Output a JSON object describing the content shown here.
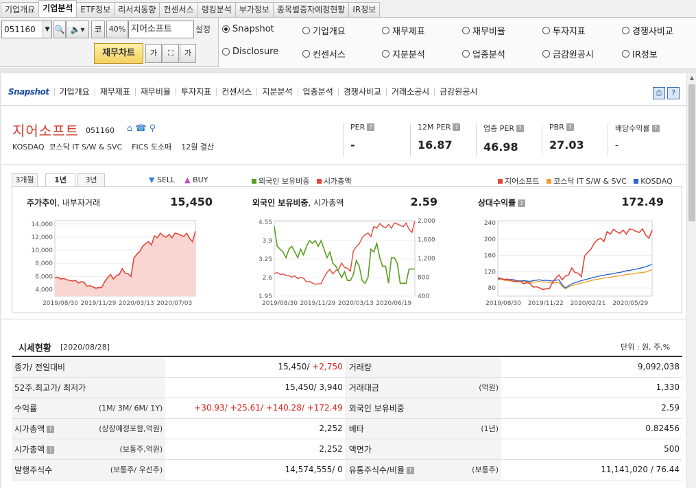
{
  "top_tabs": [
    "기업개요",
    "기업분석",
    "ETF정보",
    "리서치동향",
    "컨센서스",
    "랭킹분석",
    "부가정보",
    "종목별증자예정현황",
    "IR정보"
  ],
  "toolbar": {
    "code": "051160",
    "ratio": "40%",
    "name": "지어소프트",
    "setting": "설정",
    "chart_button": "재무차트",
    "btn_ko": "코",
    "btn_font_small": "가",
    "btn_font_large": "가"
  },
  "radios": [
    {
      "label": "Snapshot",
      "checked": true
    },
    {
      "label": "기업개요",
      "checked": false
    },
    {
      "label": "재무제표",
      "checked": false
    },
    {
      "label": "재무비율",
      "checked": false
    },
    {
      "label": "투자지표",
      "checked": false
    },
    {
      "label": "경쟁사비교",
      "checked": false
    },
    {
      "label": "Disclosure",
      "checked": false
    },
    {
      "label": "컨센서스",
      "checked": false
    },
    {
      "label": "지분분석",
      "checked": false
    },
    {
      "label": "업종분석",
      "checked": false
    },
    {
      "label": "금감원공시",
      "checked": false
    },
    {
      "label": "IR정보",
      "checked": false
    }
  ],
  "subnav": [
    "Snapshot",
    "기업개요",
    "재무제표",
    "재무비율",
    "투자지표",
    "컨센서스",
    "지분분석",
    "업종분석",
    "경쟁사비교",
    "거래소공시",
    "금감원공시"
  ],
  "company": {
    "name": "지어소프트",
    "code": "051160",
    "market": "KOSDAQ",
    "sector": "코스닥 IT S/W & SVC",
    "fics": "FICS 도소매",
    "fiscal": "12월 결산"
  },
  "metrics": [
    {
      "label": "PER",
      "value": "-"
    },
    {
      "label": "12M PER",
      "value": "16.87"
    },
    {
      "label": "업종 PER",
      "value": "46.98"
    },
    {
      "label": "PBR",
      "value": "27.03"
    },
    {
      "label": "배당수익률",
      "value": "-"
    }
  ],
  "period_tabs": [
    "3개월",
    "1년",
    "3년"
  ],
  "active_period": "1년",
  "legend_left": {
    "sell": "SELL",
    "buy": "BUY"
  },
  "legend_mid": [
    "외국인 보유비중",
    "시가총액"
  ],
  "legend_right": [
    "지어소프트",
    "코스닥 IT S/W & SVC",
    "KOSDAQ"
  ],
  "colors": {
    "red": "#e5463a",
    "green": "#5a9d1c",
    "orange": "#f0a030",
    "blue": "#2f66c8",
    "sell": "#3b7fd1",
    "buy": "#c24bc8"
  },
  "chart_titles": {
    "c1_main": "주가추이",
    "c1_sub": ", 내부자거래",
    "c1_value": "15,450",
    "c2_main": "외국인 보유비중",
    "c2_sub": ", 시가총액",
    "c2_value": "2.59",
    "c3_main": "상대수익률",
    "c3_value": "172.49"
  },
  "chart_data": [
    {
      "type": "area",
      "title": "주가추이, 내부자거래",
      "x_ticks": [
        "2019/08/30",
        "2019/11/29",
        "2020/03/13",
        "2020/07/03"
      ],
      "y_ticks": [
        "14,000",
        "12,000",
        "10,000",
        "8,000",
        "6,000",
        "4,000"
      ],
      "ylim": [
        3000,
        14500
      ],
      "series": [
        {
          "name": "주가",
          "values": [
            5800,
            5900,
            5600,
            5700,
            5500,
            5400,
            5300,
            5400,
            5000,
            5200,
            5100,
            4500,
            4600,
            4400,
            4200,
            4300,
            4300,
            5200,
            5800,
            6300,
            5600,
            6100,
            6300,
            7200,
            6500,
            6400,
            6000,
            8800,
            9400,
            9800,
            10600,
            11000,
            11300,
            10800,
            12200,
            11900,
            12600,
            12200,
            12000,
            12400,
            11900,
            12600,
            12500,
            12300,
            12100,
            12600,
            11800,
            11300,
            12900
          ]
        }
      ]
    },
    {
      "type": "line",
      "title": "외국인 보유비중, 시가총액",
      "x_ticks": [
        "2019/08/30",
        "2019/11/29",
        "2020/03/13",
        "2020/06/19"
      ],
      "y_ticks_left": [
        "4.55",
        "3.9",
        "3.25",
        "2.6",
        "1.95"
      ],
      "y_ticks_right": [
        "2,000",
        "1,600",
        "1,200",
        "800",
        "400"
      ],
      "ylim_left": [
        1.95,
        4.6
      ],
      "ylim_right": [
        400,
        2000
      ],
      "series": [
        {
          "name": "외국인 보유비중",
          "axis": "left",
          "values": [
            4.4,
            3.7,
            3.6,
            3.5,
            3.3,
            3.6,
            3.7,
            3.5,
            3.3,
            3.6,
            3.4,
            3.7,
            3.9,
            3.8,
            3.9,
            3.7,
            3.9,
            3.6,
            3.3,
            3.5,
            3.1,
            3.0,
            2.8,
            2.6,
            2.8,
            2.5,
            2.5,
            2.7,
            3.2,
            3.0,
            2.5,
            2.4,
            2.6,
            3.6,
            3.5,
            3.8,
            3.3,
            3.0,
            3.0,
            2.4,
            3.3,
            3.3,
            3.1,
            2.4,
            2.4,
            2.4,
            2.9,
            2.9,
            2.9
          ]
        },
        {
          "name": "시가총액",
          "axis": "right",
          "values": [
            880,
            900,
            860,
            870,
            840,
            830,
            800,
            830,
            770,
            800,
            780,
            700,
            710,
            680,
            650,
            660,
            660,
            800,
            900,
            970,
            870,
            940,
            970,
            1100,
            1010,
            990,
            930,
            1360,
            1450,
            1510,
            1640,
            1700,
            1740,
            1660,
            1880,
            1840,
            1940,
            1880,
            1850,
            1920,
            1840,
            1950,
            1930,
            1900,
            1870,
            1950,
            1820,
            1750,
            1990
          ]
        }
      ]
    },
    {
      "type": "line",
      "title": "상대수익률",
      "x_ticks": [
        "2019/08/30",
        "2019/11/22",
        "2020/02/21",
        "2020/05/29"
      ],
      "y_ticks": [
        "240",
        "200",
        "160",
        "120",
        "80"
      ],
      "ylim": [
        60,
        245
      ],
      "series": [
        {
          "name": "지어소프트",
          "values": [
            105,
            103,
            100,
            102,
            98,
            96,
            95,
            97,
            90,
            93,
            91,
            82,
            83,
            80,
            76,
            78,
            78,
            93,
            104,
            112,
            100,
            109,
            112,
            129,
            118,
            116,
            108,
            158,
            168,
            175,
            190,
            198,
            202,
            194,
            218,
            212,
            224,
            218,
            214,
            222,
            212,
            225,
            223,
            219,
            216,
            225,
            210,
            202,
            222
          ]
        },
        {
          "name": "코스닥 IT S/W & SVC",
          "values": [
            100,
            101,
            99,
            98,
            97,
            98,
            96,
            95,
            96,
            95,
            93,
            94,
            95,
            96,
            94,
            95,
            93,
            92,
            93,
            94,
            84,
            78,
            82,
            86,
            88,
            90,
            92,
            94,
            96,
            98,
            100,
            101,
            103,
            104,
            105,
            106,
            108,
            109,
            110,
            111,
            113,
            114,
            115,
            116,
            117,
            118,
            119,
            122,
            125
          ]
        },
        {
          "name": "KOSDAQ",
          "values": [
            102,
            103,
            101,
            100,
            101,
            100,
            98,
            97,
            98,
            97,
            96,
            98,
            99,
            100,
            98,
            99,
            98,
            97,
            99,
            100,
            88,
            80,
            85,
            90,
            93,
            95,
            98,
            100,
            102,
            104,
            106,
            108,
            110,
            111,
            113,
            114,
            115,
            117,
            118,
            120,
            122,
            123,
            125,
            126,
            128,
            130,
            132,
            135,
            138
          ]
        }
      ]
    }
  ],
  "quote": {
    "title": "시세현황",
    "date": "[2020/08/28]",
    "unit": "단위 : 원, 주,%",
    "rows": [
      {
        "k": "종가/ 전일대비",
        "kn": "",
        "v_main": "15,450/",
        "v_red": "+2,750",
        "k2": "거래량",
        "kn2": "",
        "v2": "9,092,038"
      },
      {
        "k": "52주.최고가/ 최저가",
        "kn": "",
        "v_main": "15,450/ 3,940",
        "v_red": "",
        "k2": "거래대금",
        "kn2": "(억원)",
        "v2": "1,330"
      },
      {
        "k": "수익률",
        "kn": "(1M/ 3M/ 6M/ 1Y)",
        "v_main": "",
        "v_red": "+30.93/ +25.61/ +140.28/ +172.49",
        "k2": "외국인 보유비중",
        "kn2": "",
        "v2": "2.59"
      },
      {
        "k": "시가총액",
        "kn": "(상장예정포함,억원)",
        "v_main": "2,252",
        "v_red": "",
        "k2": "베타",
        "kn2": "(1년)",
        "v2": "0.82456"
      },
      {
        "k": "시가총액",
        "kn": "(보통주,억원)",
        "v_main": "2,252",
        "v_red": "",
        "k2": "액면가",
        "kn2": "",
        "v2": "500"
      },
      {
        "k": "발행주식수",
        "kn": "(보통주/ 우선주)",
        "v_main": "14,574,555/ 0",
        "v_red": "",
        "k2": "유통주식수/비율",
        "kn2": "(보통주)",
        "v2": "11,141,020 / 76.44"
      }
    ]
  }
}
